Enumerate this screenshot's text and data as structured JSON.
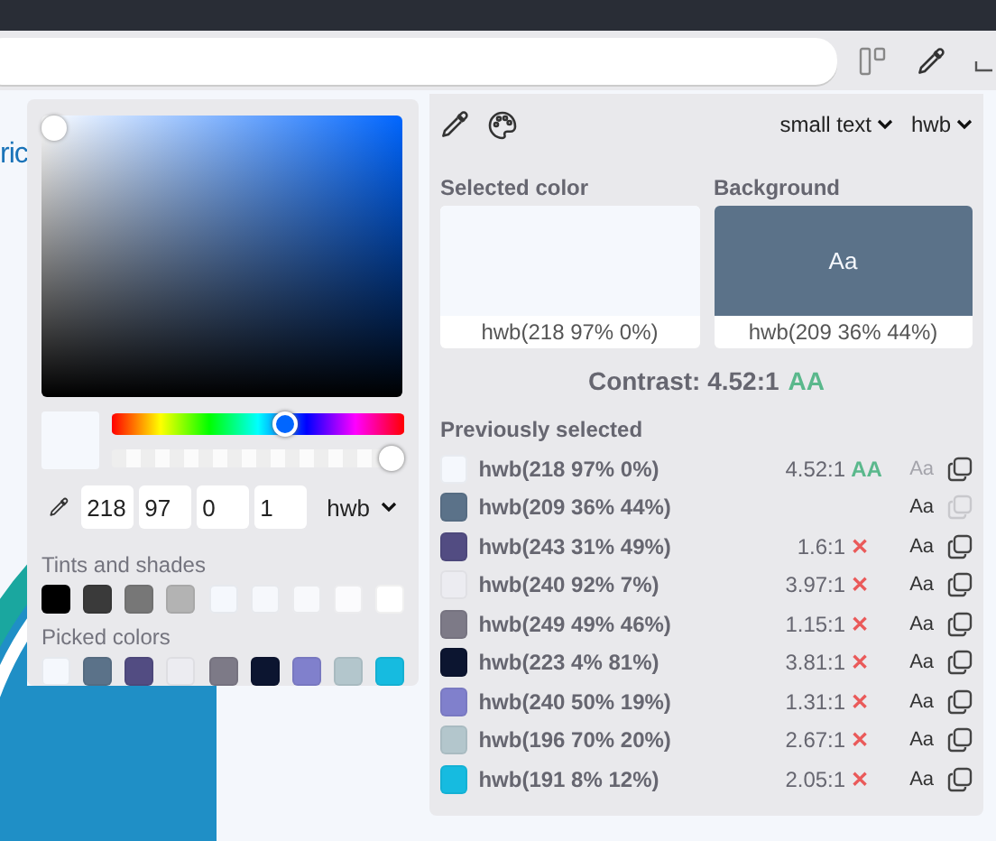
{
  "page": {
    "link_text": "ric"
  },
  "picker": {
    "hue": {
      "level": 0.6
    },
    "alpha": {
      "level": 1
    },
    "inputs": [
      "218",
      "97",
      "0",
      "1"
    ],
    "format": "hwb",
    "tints_label": "Tints and shades",
    "tints": [
      {
        "color": "#000000"
      },
      {
        "color": "#3a3a3a"
      },
      {
        "color": "#777777"
      },
      {
        "color": "#b3b3b3"
      },
      {
        "color": "#f5f8fd"
      },
      {
        "color": "#f6f8fc"
      },
      {
        "color": "#f8f9fc"
      },
      {
        "color": "#fbfbfd"
      },
      {
        "color": "#ffffff"
      }
    ],
    "picked_label": "Picked colors",
    "picked": [
      {
        "color": "#f5f8fd"
      },
      {
        "color": "#5b7289"
      },
      {
        "color": "#524c82"
      },
      {
        "color": "#ececf1"
      },
      {
        "color": "#7d7a87"
      },
      {
        "color": "#0c1530"
      },
      {
        "color": "#8080cc"
      },
      {
        "color": "#b3c6cc"
      },
      {
        "color": "#16bbe0"
      }
    ]
  },
  "contrast": {
    "text_size": "small text",
    "format": "hwb",
    "cards": [
      {
        "label": "Selected color",
        "color": "#f5f8fd",
        "value": "hwb(218 97% 0%)"
      },
      {
        "label": "Background",
        "color": "#5b7289",
        "sample": "Aa",
        "value": "hwb(209 36% 44%)"
      }
    ],
    "result": "Contrast: 4.52:1",
    "rating": "AA",
    "history_label": "Previously selected",
    "history": [
      {
        "color": "#f5f8fd",
        "value": "hwb(218 97% 0%)",
        "ratio": "4.52:1",
        "kind": "pass",
        "mark": "AA",
        "preview": "Aa",
        "preview_disabled": true,
        "copy_disabled": false
      },
      {
        "color": "#5b7289",
        "value": "hwb(209 36% 44%)",
        "kind": "none",
        "preview": "Aa",
        "preview_disabled": false,
        "copy_disabled": true
      },
      {
        "color": "#524c82",
        "value": "hwb(243 31% 49%)",
        "ratio": "1.6:1",
        "kind": "fail",
        "mark": "✕",
        "preview": "Aa",
        "preview_disabled": false,
        "copy_disabled": false
      },
      {
        "color": "#ececf1",
        "value": "hwb(240 92% 7%)",
        "ratio": "3.97:1",
        "kind": "fail",
        "mark": "✕",
        "preview": "Aa",
        "preview_disabled": false,
        "copy_disabled": false
      },
      {
        "color": "#7d7a87",
        "value": "hwb(249 49% 46%)",
        "ratio": "1.15:1",
        "kind": "fail",
        "mark": "✕",
        "preview": "Aa",
        "preview_disabled": false,
        "copy_disabled": false
      },
      {
        "color": "#0c1530",
        "value": "hwb(223 4% 81%)",
        "ratio": "3.81:1",
        "kind": "fail",
        "mark": "✕",
        "preview": "Aa",
        "preview_disabled": false,
        "copy_disabled": false
      },
      {
        "color": "#8080cc",
        "value": "hwb(240 50% 19%)",
        "ratio": "1.31:1",
        "kind": "fail",
        "mark": "✕",
        "preview": "Aa",
        "preview_disabled": false,
        "copy_disabled": false
      },
      {
        "color": "#b3c6cc",
        "value": "hwb(196 70% 20%)",
        "ratio": "2.67:1",
        "kind": "fail",
        "mark": "✕",
        "preview": "Aa",
        "preview_disabled": false,
        "copy_disabled": false
      },
      {
        "color": "#16bbe0",
        "value": "hwb(191 8% 12%)",
        "ratio": "2.05:1",
        "kind": "fail",
        "mark": "✕",
        "preview": "Aa",
        "preview_disabled": false,
        "copy_disabled": false
      }
    ]
  }
}
